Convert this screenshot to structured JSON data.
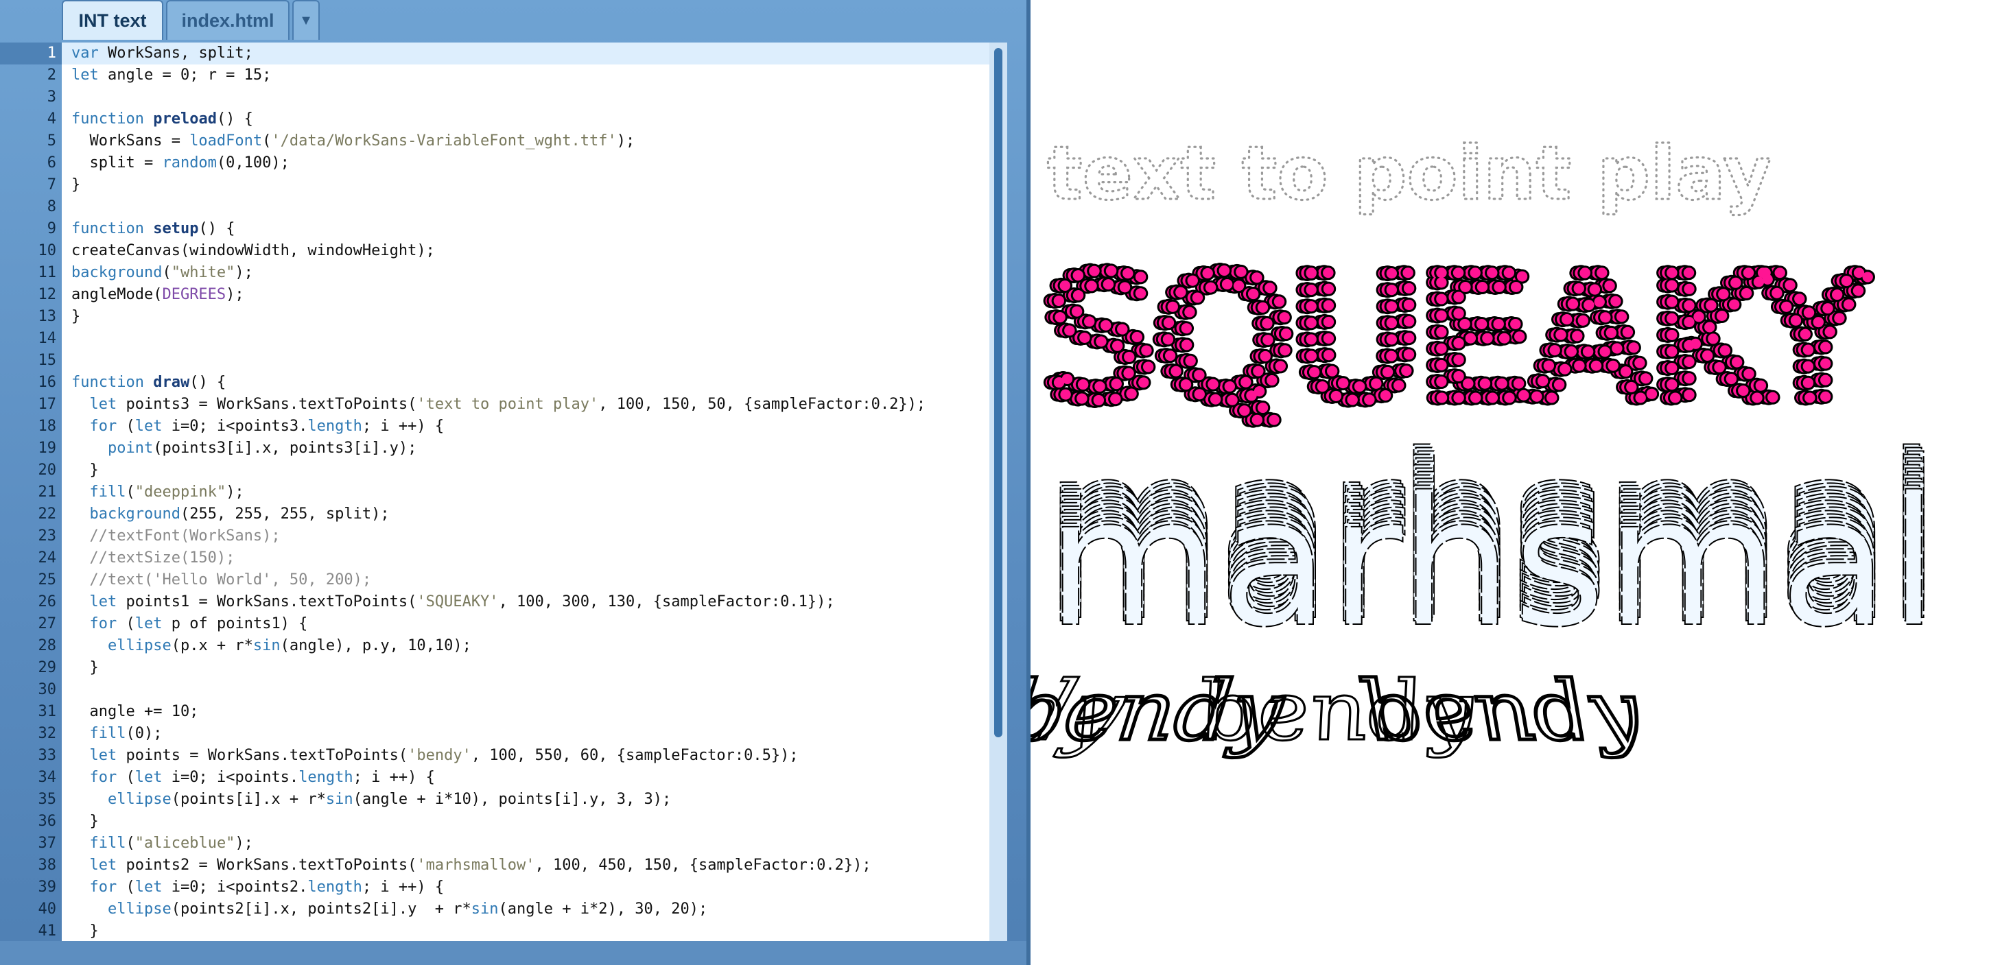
{
  "tabs": [
    {
      "label": "INT text",
      "active": true
    },
    {
      "label": "index.html",
      "active": false
    }
  ],
  "tab_menu_icon": "dropdown-arrow-icon",
  "editor": {
    "current_line": 1,
    "lines": [
      [
        [
          "k",
          "var"
        ],
        [
          "p",
          " WorkSans, split;"
        ]
      ],
      [
        [
          "k",
          "let"
        ],
        [
          "p",
          " angle = 0; r = 15;"
        ]
      ],
      [],
      [
        [
          "k",
          "function"
        ],
        [
          "p",
          " "
        ],
        [
          "fn",
          "preload"
        ],
        [
          "p",
          "() {"
        ]
      ],
      [
        [
          "p",
          "  WorkSans = "
        ],
        [
          "bi",
          "loadFont"
        ],
        [
          "p",
          "("
        ],
        [
          "s",
          "'/data/WorkSans-VariableFont_wght.ttf'"
        ],
        [
          "p",
          ");"
        ]
      ],
      [
        [
          "p",
          "  split = "
        ],
        [
          "bi",
          "random"
        ],
        [
          "p",
          "(0,100);"
        ]
      ],
      [
        [
          "p",
          "}"
        ]
      ],
      [],
      [
        [
          "k",
          "function"
        ],
        [
          "p",
          " "
        ],
        [
          "fn",
          "setup"
        ],
        [
          "p",
          "() {"
        ]
      ],
      [
        [
          "p",
          "createCanvas(windowWidth, windowHeight);"
        ]
      ],
      [
        [
          "bi",
          "background"
        ],
        [
          "p",
          "("
        ],
        [
          "s",
          "\"white\""
        ],
        [
          "p",
          ");"
        ]
      ],
      [
        [
          "p",
          "angleMode("
        ],
        [
          "cn",
          "DEGREES"
        ],
        [
          "p",
          ");"
        ]
      ],
      [
        [
          "p",
          "}"
        ]
      ],
      [],
      [],
      [
        [
          "k",
          "function"
        ],
        [
          "p",
          " "
        ],
        [
          "fn",
          "draw"
        ],
        [
          "p",
          "() {"
        ]
      ],
      [
        [
          "p",
          "  "
        ],
        [
          "k",
          "let"
        ],
        [
          "p",
          " points3 = WorkSans.textToPoints("
        ],
        [
          "s",
          "'text to point play'"
        ],
        [
          "p",
          ", 100, 150, 50, {sampleFactor:0.2});"
        ]
      ],
      [
        [
          "p",
          "  "
        ],
        [
          "k",
          "for"
        ],
        [
          "p",
          " ("
        ],
        [
          "k",
          "let"
        ],
        [
          "p",
          " i=0; i<points3."
        ],
        [
          "bi",
          "length"
        ],
        [
          "p",
          "; i ++) {"
        ]
      ],
      [
        [
          "p",
          "    "
        ],
        [
          "bi",
          "point"
        ],
        [
          "p",
          "(points3[i].x, points3[i].y);"
        ]
      ],
      [
        [
          "p",
          "  }"
        ]
      ],
      [
        [
          "p",
          "  "
        ],
        [
          "bi",
          "fill"
        ],
        [
          "p",
          "("
        ],
        [
          "s",
          "\"deeppink\""
        ],
        [
          "p",
          ");"
        ]
      ],
      [
        [
          "p",
          "  "
        ],
        [
          "bi",
          "background"
        ],
        [
          "p",
          "(255, 255, 255, split);"
        ]
      ],
      [
        [
          "c",
          "  //textFont(WorkSans);"
        ]
      ],
      [
        [
          "c",
          "  //textSize(150);"
        ]
      ],
      [
        [
          "c",
          "  //text('Hello World', 50, 200);"
        ]
      ],
      [
        [
          "p",
          "  "
        ],
        [
          "k",
          "let"
        ],
        [
          "p",
          " points1 = WorkSans.textToPoints("
        ],
        [
          "s",
          "'SQUEAKY'"
        ],
        [
          "p",
          ", 100, 300, 130, {sampleFactor:0.1});"
        ]
      ],
      [
        [
          "p",
          "  "
        ],
        [
          "k",
          "for"
        ],
        [
          "p",
          " ("
        ],
        [
          "k",
          "let"
        ],
        [
          "p",
          " p of points1) {"
        ]
      ],
      [
        [
          "p",
          "    "
        ],
        [
          "bi",
          "ellipse"
        ],
        [
          "p",
          "(p.x + r*"
        ],
        [
          "bi",
          "sin"
        ],
        [
          "p",
          "(angle), p.y, 10,10);"
        ]
      ],
      [
        [
          "p",
          "  }"
        ]
      ],
      [],
      [
        [
          "p",
          "  angle += 10;"
        ]
      ],
      [
        [
          "p",
          "  "
        ],
        [
          "bi",
          "fill"
        ],
        [
          "p",
          "(0);"
        ]
      ],
      [
        [
          "p",
          "  "
        ],
        [
          "k",
          "let"
        ],
        [
          "p",
          " points = WorkSans.textToPoints("
        ],
        [
          "s",
          "'bendy'"
        ],
        [
          "p",
          ", 100, 550, 60, {sampleFactor:0.5});"
        ]
      ],
      [
        [
          "p",
          "  "
        ],
        [
          "k",
          "for"
        ],
        [
          "p",
          " ("
        ],
        [
          "k",
          "let"
        ],
        [
          "p",
          " i=0; i<points."
        ],
        [
          "bi",
          "length"
        ],
        [
          "p",
          "; i ++) {"
        ]
      ],
      [
        [
          "p",
          "    "
        ],
        [
          "bi",
          "ellipse"
        ],
        [
          "p",
          "(points[i].x + r*"
        ],
        [
          "bi",
          "sin"
        ],
        [
          "p",
          "(angle + i*10), points[i].y, 3, 3);"
        ]
      ],
      [
        [
          "p",
          "  }"
        ]
      ],
      [
        [
          "p",
          "  "
        ],
        [
          "bi",
          "fill"
        ],
        [
          "p",
          "("
        ],
        [
          "s",
          "\"aliceblue\""
        ],
        [
          "p",
          ");"
        ]
      ],
      [
        [
          "p",
          "  "
        ],
        [
          "k",
          "let"
        ],
        [
          "p",
          " points2 = WorkSans.textToPoints("
        ],
        [
          "s",
          "'marhsmallow'"
        ],
        [
          "p",
          ", 100, 450, 150, {sampleFactor:0.2});"
        ]
      ],
      [
        [
          "p",
          "  "
        ],
        [
          "k",
          "for"
        ],
        [
          "p",
          " ("
        ],
        [
          "k",
          "let"
        ],
        [
          "p",
          " i=0; i<points2."
        ],
        [
          "bi",
          "length"
        ],
        [
          "p",
          "; i ++) {"
        ]
      ],
      [
        [
          "p",
          "    "
        ],
        [
          "bi",
          "ellipse"
        ],
        [
          "p",
          "(points2[i].x, points2[i].y  + r*"
        ],
        [
          "bi",
          "sin"
        ],
        [
          "p",
          "(angle + i*2), 30, 20);"
        ]
      ],
      [
        [
          "p",
          "  }"
        ]
      ]
    ]
  },
  "preview": {
    "dotted_text": "text to point play",
    "squeaky_text": "SQUEAKY",
    "marsh_text": "marhsmal",
    "bendy_text": "bendy",
    "colors": {
      "dotted": "#9a9a9a",
      "squeaky_fill": "#ff1493",
      "marsh_fill": "#f0f8ff",
      "bendy_fill": "#000000",
      "outline": "#000000"
    }
  }
}
